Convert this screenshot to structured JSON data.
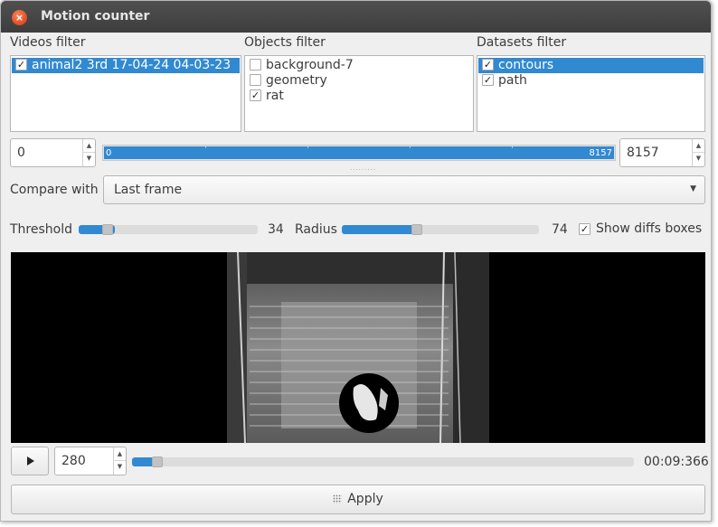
{
  "window": {
    "title": "Motion counter",
    "close_glyph": "×"
  },
  "videos_filter": {
    "label": "Videos filter",
    "items": [
      {
        "label": "animal2 3rd 17-04-24 04-03-23",
        "checked": true,
        "selected": true
      }
    ]
  },
  "objects_filter": {
    "label": "Objects filter",
    "items": [
      {
        "label": "background-7",
        "checked": false,
        "selected": false
      },
      {
        "label": "geometry",
        "checked": false,
        "selected": false
      },
      {
        "label": "rat",
        "checked": true,
        "selected": false
      }
    ]
  },
  "datasets_filter": {
    "label": "Datasets filter",
    "items": [
      {
        "label": "contours",
        "checked": true,
        "selected": true
      },
      {
        "label": "path",
        "checked": true,
        "selected": false
      }
    ]
  },
  "range": {
    "start_value": "0",
    "end_value": "8157",
    "min_label": "0",
    "max_label": "8157"
  },
  "compare": {
    "label": "Compare with",
    "selected": "Last frame"
  },
  "threshold": {
    "label": "Threshold",
    "value": "34",
    "fraction": 0.2
  },
  "radius": {
    "label": "Radius",
    "value": "74",
    "fraction": 0.4
  },
  "show_diffs": {
    "label": "Show diffs boxes",
    "checked": true
  },
  "player": {
    "frame_value": "280",
    "time": "00:09:366",
    "progress_fraction": 0.05
  },
  "apply": {
    "label": "Apply"
  },
  "colors": {
    "accent": "#3189d1",
    "titlebar": "#3d3d3d",
    "close": "#e4532a",
    "window_bg": "#efefef"
  }
}
